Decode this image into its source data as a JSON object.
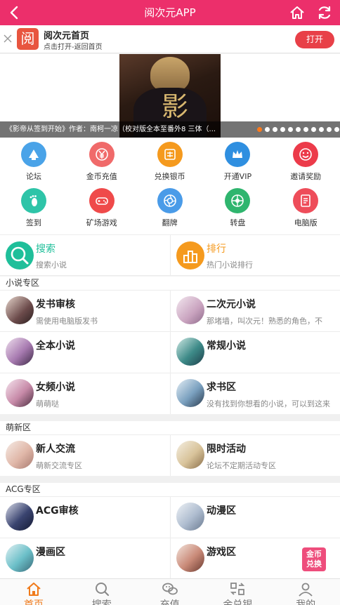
{
  "header": {
    "title": "阅次元APP",
    "bg_color": "#ec2f6b",
    "icons": [
      "back-icon",
      "home-icon",
      "refresh-icon"
    ]
  },
  "app_banner": {
    "logo_char": "阅",
    "name": "阅次元首页",
    "subtitle": "点击打开-返回首页",
    "open_label": "打开"
  },
  "carousel": {
    "caption": "《影帝从签到开始》作者：南柯一凉（校对版全本至番外8 三体（...",
    "cover_glyph": "影",
    "dot_count": 11,
    "active_dot": 0
  },
  "quick_links": [
    {
      "label": "论坛",
      "icon": "forum-icon",
      "color": "#4aa3e8"
    },
    {
      "label": "金币充值",
      "icon": "yen-coin-icon",
      "color": "#f06a6a"
    },
    {
      "label": "兑换银币",
      "icon": "exchange-icon",
      "color": "#f59a1e"
    },
    {
      "label": "开通VIP",
      "icon": "crown-icon",
      "color": "#2f8fe0"
    },
    {
      "label": "邀请奖励",
      "icon": "smile-icon",
      "color": "#ec3b4a"
    },
    {
      "label": "签到",
      "icon": "footprint-icon",
      "color": "#2ec4a8"
    },
    {
      "label": "矿场游戏",
      "icon": "gamepad-icon",
      "color": "#ef4a4a"
    },
    {
      "label": "翻牌",
      "icon": "aperture-icon",
      "color": "#4a9be8"
    },
    {
      "label": "转盘",
      "icon": "wheel-icon",
      "color": "#2fb56e"
    },
    {
      "label": "电脑版",
      "icon": "document-icon",
      "color": "#ee4d5a"
    }
  ],
  "search_tile": {
    "title": "搜索",
    "subtitle": "搜索小说",
    "color": "#1fbf9a"
  },
  "rank_tile": {
    "title": "排行",
    "subtitle": "热门小说排行",
    "color": "#f59a1e"
  },
  "sections": [
    {
      "title": "小说专区",
      "items": [
        {
          "title": "发书审核",
          "subtitle": "需使用电脑版发书"
        },
        {
          "title": "二次元小说",
          "subtitle": "那堵墙，叫次元！熟悉的角色，不"
        },
        {
          "title": "全本小说",
          "subtitle": ""
        },
        {
          "title": "常规小说",
          "subtitle": ""
        },
        {
          "title": "女频小说",
          "subtitle": "萌萌哒"
        },
        {
          "title": "求书区",
          "subtitle": "没有找到你想看的小说，可以到这来"
        }
      ]
    },
    {
      "title": "萌新区",
      "items": [
        {
          "title": "新人交流",
          "subtitle": "萌新交流专区"
        },
        {
          "title": "限时活动",
          "subtitle": "论坛不定期活动专区"
        }
      ]
    },
    {
      "title": "ACG专区",
      "items": [
        {
          "title": "ACG审核",
          "subtitle": ""
        },
        {
          "title": "动漫区",
          "subtitle": ""
        },
        {
          "title": "漫画区",
          "subtitle": ""
        },
        {
          "title": "游戏区",
          "subtitle": ""
        }
      ]
    }
  ],
  "coin_badge": {
    "line1": "金币",
    "line2": "兑换"
  },
  "bottom_nav": [
    {
      "label": "首页",
      "icon": "home-icon",
      "active": true
    },
    {
      "label": "搜索",
      "icon": "search-icon",
      "active": false
    },
    {
      "label": "充值",
      "icon": "wechat-icon",
      "active": false
    },
    {
      "label": "金兑银",
      "icon": "exchange-icon",
      "active": false
    },
    {
      "label": "我的",
      "icon": "user-icon",
      "active": false
    }
  ],
  "accent_color": "#f07a1a"
}
